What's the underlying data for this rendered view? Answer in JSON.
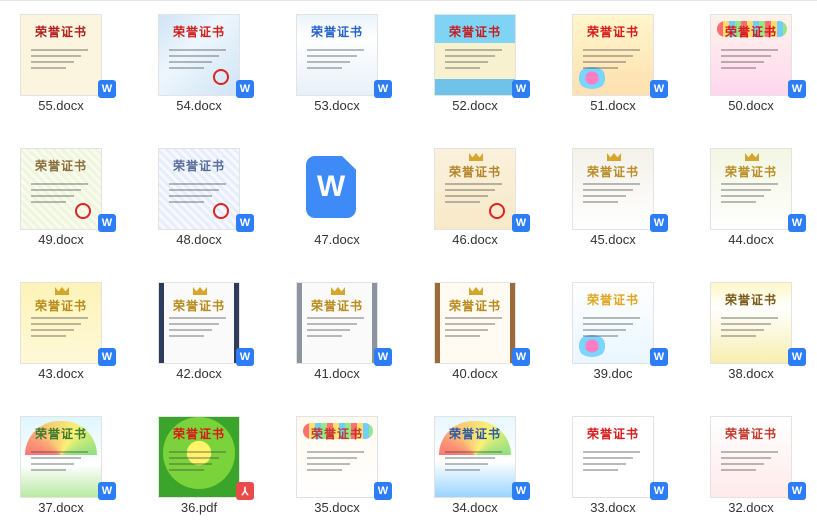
{
  "colors": {
    "accent": "#2c7df6",
    "pdf": "#e94b4b",
    "text": "#333333"
  },
  "files": [
    {
      "name": "55.docx",
      "type": "docx",
      "thumb_title": "荣誉证书",
      "style": "plain-cream",
      "title_color": "#b11e1e"
    },
    {
      "name": "54.docx",
      "type": "docx",
      "thumb_title": "荣誉证书",
      "style": "blue-border",
      "title_color": "#d0201d"
    },
    {
      "name": "53.docx",
      "type": "docx",
      "thumb_title": "荣誉证书",
      "style": "white-blue",
      "title_color": "#2563c7"
    },
    {
      "name": "52.docx",
      "type": "docx",
      "thumb_title": "荣誉证书",
      "style": "beach",
      "title_color": "#c21f1f"
    },
    {
      "name": "51.docx",
      "type": "docx",
      "thumb_title": "荣誉证书",
      "style": "cartoon",
      "title_color": "#d61919"
    },
    {
      "name": "50.docx",
      "type": "docx",
      "thumb_title": "荣誉证书",
      "style": "party",
      "title_color": "#d61919"
    },
    {
      "name": "49.docx",
      "type": "docx",
      "thumb_title": "荣誉证书",
      "style": "green-guilloche",
      "title_color": "#8a6d3b"
    },
    {
      "name": "48.docx",
      "type": "docx",
      "thumb_title": "荣誉证书",
      "style": "blue-guilloche",
      "title_color": "#5a6c9a"
    },
    {
      "name": "47.docx",
      "type": "docx-icon",
      "thumb_title": "",
      "style": "icon",
      "title_color": "#ffffff"
    },
    {
      "name": "46.docx",
      "type": "docx",
      "thumb_title": "荣誉证书",
      "style": "beige-gold",
      "title_color": "#b4842a"
    },
    {
      "name": "45.docx",
      "type": "docx",
      "thumb_title": "荣誉证书",
      "style": "gray-gold",
      "title_color": "#b98c25"
    },
    {
      "name": "44.docx",
      "type": "docx",
      "thumb_title": "荣誉证书",
      "style": "green-gold",
      "title_color": "#b98c25"
    },
    {
      "name": "43.docx",
      "type": "docx",
      "thumb_title": "荣誉证书",
      "style": "yellow-gold",
      "title_color": "#b88a1a"
    },
    {
      "name": "42.docx",
      "type": "docx",
      "thumb_title": "荣誉证书",
      "style": "navy-gold",
      "title_color": "#b88a1a"
    },
    {
      "name": "41.docx",
      "type": "docx",
      "thumb_title": "荣誉证书",
      "style": "gray-gold2",
      "title_color": "#b88a1a"
    },
    {
      "name": "40.docx",
      "type": "docx",
      "thumb_title": "荣誉证书",
      "style": "brown-gold",
      "title_color": "#b88a1a"
    },
    {
      "name": "39.doc",
      "type": "docx",
      "thumb_title": "荣誉证书",
      "style": "floral",
      "title_color": "#e0a51d"
    },
    {
      "name": "38.docx",
      "type": "docx",
      "thumb_title": "荣誉证书",
      "style": "flower-border",
      "title_color": "#7a5a1a"
    },
    {
      "name": "37.docx",
      "type": "docx",
      "thumb_title": "荣誉证书",
      "style": "rainbow",
      "title_color": "#3a7a2a"
    },
    {
      "name": "36.pdf",
      "type": "pdf",
      "thumb_title": "荣誉证书",
      "style": "green-sun",
      "title_color": "#d61919"
    },
    {
      "name": "35.docx",
      "type": "docx",
      "thumb_title": "荣誉证书",
      "style": "balloons",
      "title_color": "#c0392b"
    },
    {
      "name": "34.docx",
      "type": "docx",
      "thumb_title": "荣誉证书",
      "style": "rainbow2",
      "title_color": "#2a5aa0"
    },
    {
      "name": "33.docx",
      "type": "docx",
      "thumb_title": "荣誉证书",
      "style": "red-frame",
      "title_color": "#d61919"
    },
    {
      "name": "32.docx",
      "type": "docx",
      "thumb_title": "荣誉证书",
      "style": "red-paper",
      "title_color": "#c0392b"
    }
  ]
}
